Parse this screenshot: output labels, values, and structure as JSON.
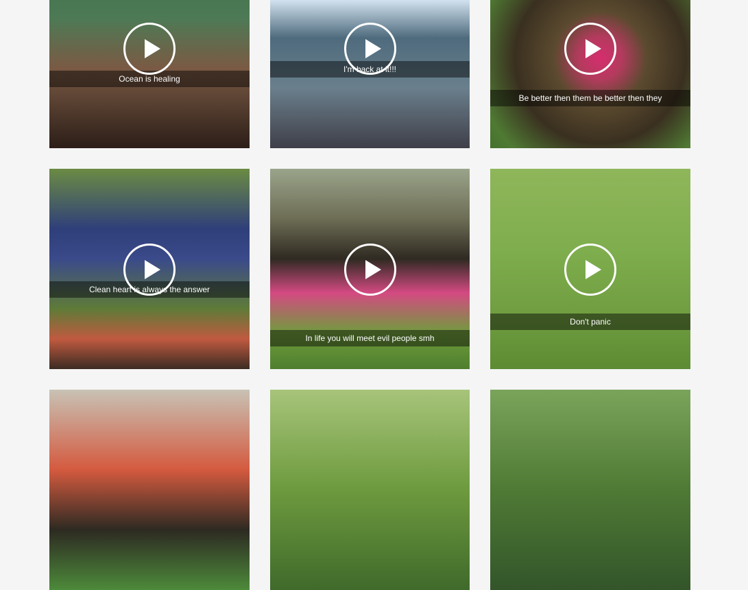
{
  "videos": [
    {
      "caption": "Ocean is healing",
      "thumb": "man-in-water"
    },
    {
      "caption": "I'm back at it!!!",
      "thumb": "man-on-boat"
    },
    {
      "caption": "Be better then them be better then they",
      "thumb": "bromeliad-plant"
    },
    {
      "caption": "Clean heart is always the answer",
      "thumb": "man-gardening"
    },
    {
      "caption": "In life you will meet evil people smh",
      "thumb": "bromeliad-plant"
    },
    {
      "caption": "Don't panic",
      "thumb": "grass-lawn"
    },
    {
      "caption": "",
      "thumb": "garden-plants"
    },
    {
      "caption": "",
      "thumb": "tropical-leaves"
    },
    {
      "caption": "",
      "thumb": "green-hedge"
    }
  ],
  "icons": {
    "play": "play-icon"
  }
}
